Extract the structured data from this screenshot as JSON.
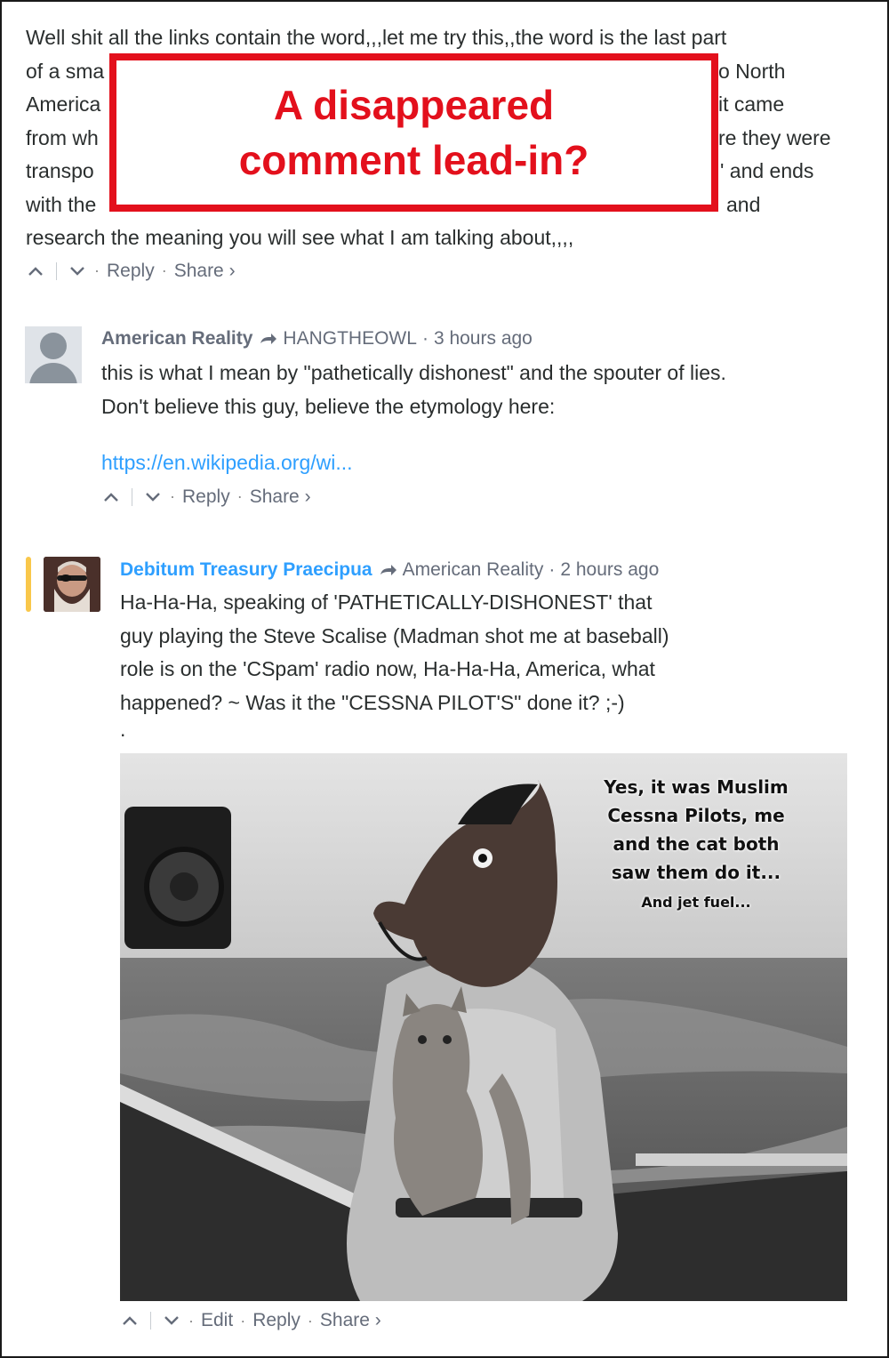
{
  "comment1": {
    "lines": [
      "Well shit all the links contain the word,,,let me try this,,the word is the last part",
      "of a sma",
      "America",
      "from wh",
      "transpo",
      "with the",
      "research the meaning you will see what I am talking about,,,,"
    ],
    "right_fragments": [
      "o North",
      "it came",
      "re they were",
      "' and ends",
      "and"
    ],
    "reply_label": "Reply",
    "share_label": "Share ›"
  },
  "overlay": {
    "line1": "A disappeared",
    "line2": "comment lead-in?",
    "color": "#e3101c"
  },
  "comment2": {
    "author": "American Reality",
    "reply_to": "HANGTHEOWL",
    "time": "3 hours ago",
    "line1": "this is what I mean by \"pathetically dishonest\" and the spouter of lies.",
    "line2": "Don't believe this guy, believe the etymology here:",
    "link": "https://en.wikipedia.org/wi...",
    "reply_label": "Reply",
    "share_label": "Share ›"
  },
  "comment3": {
    "author": "Debitum Treasury Praecipua",
    "reply_to": "American Reality",
    "time": "2 hours ago",
    "lines": [
      "Ha-Ha-Ha, speaking of 'PATHETICALLY-DISHONEST' that",
      "guy playing the Steve Scalise (Madman shot me at baseball)",
      "role is on the 'CSpam' radio now, Ha-Ha-Ha, America, what",
      "happened? ~ Was it the \"CESSNA PILOT'S\" done it? ;-)"
    ],
    "dot": ".",
    "image_caption": [
      "Yes, it was Muslim",
      "Cessna Pilots, me",
      "and the cat both",
      "saw them do it..."
    ],
    "image_caption_small": "And jet fuel...",
    "edit_label": "Edit",
    "reply_label": "Reply",
    "share_label": "Share ›"
  },
  "colors": {
    "text": "#2a2e2e",
    "meta": "#656c7a",
    "link": "#2e9fff",
    "highlight": "#f9c74a"
  }
}
